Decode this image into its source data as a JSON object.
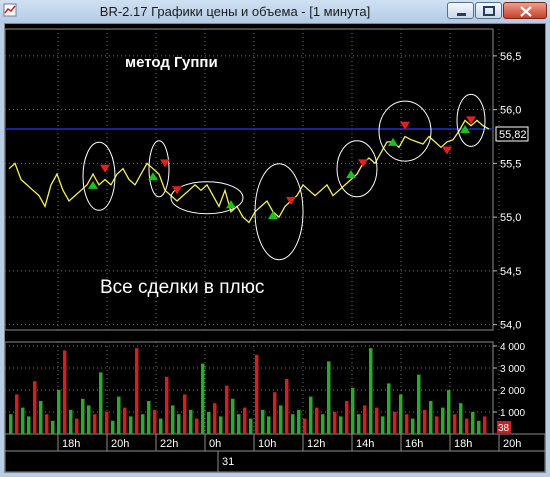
{
  "window": {
    "title": "BR-2.17 Графики цены и объема - [1 минута]",
    "buttons": [
      "minimize-icon",
      "maximize-icon",
      "close-icon"
    ]
  },
  "chart": {
    "annotation_title": "метод Гуппи",
    "annotation_bottom": "Все сделки в плюс",
    "current_price": "55,82"
  },
  "colors": {
    "background": "#000000",
    "price_line": "#f5f05a",
    "horizontal_line": "#1c2fd8",
    "buy_marker": "#19c41a",
    "sell_marker": "#e3201d",
    "circle": "#ffffff",
    "volume_green": "#2ea82e",
    "volume_red": "#cc2222"
  },
  "chart_data": [
    {
      "type": "line",
      "name": "price",
      "y_ticks": [
        "56,5",
        "56,0",
        "55,5",
        "55,0",
        "54,5",
        "54,0"
      ],
      "ylim": [
        53.95,
        56.75
      ],
      "x_ticks": [
        "18h",
        "20h",
        "22h",
        "0h",
        "10h",
        "12h",
        "14h",
        "16h",
        "18h",
        "20h"
      ],
      "x_secondary_label": "31",
      "x_hours": [
        0,
        1,
        2,
        3,
        4,
        5,
        6,
        7,
        8,
        9,
        10,
        11,
        12,
        13,
        14,
        15,
        16,
        17,
        18,
        19,
        20,
        21,
        22,
        23,
        24,
        25,
        26,
        27,
        28,
        29,
        30,
        31,
        32,
        33,
        34,
        35,
        36,
        37,
        38,
        39,
        40,
        41,
        42,
        43,
        44,
        45,
        46,
        47,
        48,
        49,
        50,
        51,
        52,
        53,
        54,
        55,
        56,
        57,
        58,
        59,
        60,
        61,
        62,
        63,
        64,
        65,
        66,
        67,
        68,
        69,
        70,
        71,
        72,
        73,
        74,
        75,
        76,
        77,
        78,
        79,
        80
      ],
      "y": [
        55.45,
        55.5,
        55.35,
        55.3,
        55.25,
        55.2,
        55.1,
        55.3,
        55.4,
        55.25,
        55.15,
        55.2,
        55.25,
        55.3,
        55.4,
        55.3,
        55.35,
        55.3,
        55.4,
        55.45,
        55.35,
        55.3,
        55.4,
        55.5,
        55.45,
        55.4,
        55.25,
        55.2,
        55.15,
        55.2,
        55.25,
        55.3,
        55.25,
        55.3,
        55.2,
        55.1,
        55.25,
        55.05,
        55.1,
        55.0,
        54.95,
        55.05,
        55.1,
        55.15,
        55.05,
        55.0,
        55.1,
        55.15,
        55.2,
        55.3,
        55.25,
        55.2,
        55.25,
        55.3,
        55.2,
        55.25,
        55.3,
        55.35,
        55.4,
        55.5,
        55.55,
        55.5,
        55.6,
        55.7,
        55.7,
        55.65,
        55.75,
        55.72,
        55.7,
        55.68,
        55.75,
        55.7,
        55.65,
        55.7,
        55.72,
        55.8,
        55.9,
        55.85,
        55.9,
        55.85,
        55.82
      ],
      "series": [
        {
          "name": "buy",
          "values": [
            {
              "x": 14,
              "y": 55.3
            },
            {
              "x": 24,
              "y": 55.38
            },
            {
              "x": 37,
              "y": 55.12
            },
            {
              "x": 44,
              "y": 55.02
            },
            {
              "x": 57,
              "y": 55.4
            },
            {
              "x": 64,
              "y": 55.7
            },
            {
              "x": 76,
              "y": 55.82
            }
          ]
        },
        {
          "name": "sell",
          "values": [
            {
              "x": 16,
              "y": 55.45
            },
            {
              "x": 26,
              "y": 55.5
            },
            {
              "x": 28,
              "y": 55.25
            },
            {
              "x": 47,
              "y": 55.15
            },
            {
              "x": 59,
              "y": 55.5
            },
            {
              "x": 66,
              "y": 55.85
            },
            {
              "x": 73,
              "y": 55.62
            },
            {
              "x": 77,
              "y": 55.9
            }
          ]
        }
      ],
      "reference_line": 55.82
    },
    {
      "type": "bar",
      "name": "volume",
      "y_ticks": [
        "4 000",
        "3 000",
        "2 000",
        "1 000"
      ],
      "ylim": [
        0,
        4000
      ],
      "current_value_label": "38",
      "values": [
        900,
        1800,
        1200,
        800,
        2400,
        1500,
        900,
        600,
        2000,
        3800,
        1100,
        700,
        1600,
        1300,
        900,
        2800,
        1000,
        600,
        1700,
        1200,
        800,
        3900,
        900,
        1500,
        1100,
        700,
        2600,
        1300,
        900,
        1800,
        1100,
        700,
        3200,
        1000,
        1400,
        800,
        2200,
        1600,
        900,
        1200,
        700,
        3600,
        1100,
        800,
        1900,
        1300,
        2500,
        900,
        1100,
        700,
        1700,
        1200,
        900,
        3300,
        1000,
        800,
        1500,
        2100,
        900,
        1300,
        3900,
        1200,
        800,
        2300,
        1000,
        1800,
        900,
        700,
        2700,
        1100,
        1500,
        800,
        1200,
        2000,
        900,
        1400,
        700,
        1000,
        600,
        800
      ],
      "colors_by_bar": [
        "g",
        "r",
        "g",
        "g",
        "r",
        "g",
        "r",
        "g",
        "g",
        "r",
        "g",
        "r",
        "g",
        "g",
        "r",
        "g",
        "r",
        "g",
        "g",
        "r",
        "g",
        "r",
        "g",
        "g",
        "r",
        "g",
        "r",
        "g",
        "g",
        "r",
        "g",
        "r",
        "g",
        "g",
        "r",
        "g",
        "r",
        "g",
        "g",
        "r",
        "g",
        "r",
        "g",
        "g",
        "r",
        "g",
        "r",
        "g",
        "g",
        "r",
        "g",
        "r",
        "g",
        "g",
        "r",
        "g",
        "r",
        "g",
        "g",
        "r",
        "g",
        "r",
        "g",
        "g",
        "r",
        "g",
        "r",
        "g",
        "g",
        "r",
        "g",
        "r",
        "g",
        "g",
        "r",
        "g",
        "r",
        "g",
        "g",
        "r"
      ]
    }
  ]
}
